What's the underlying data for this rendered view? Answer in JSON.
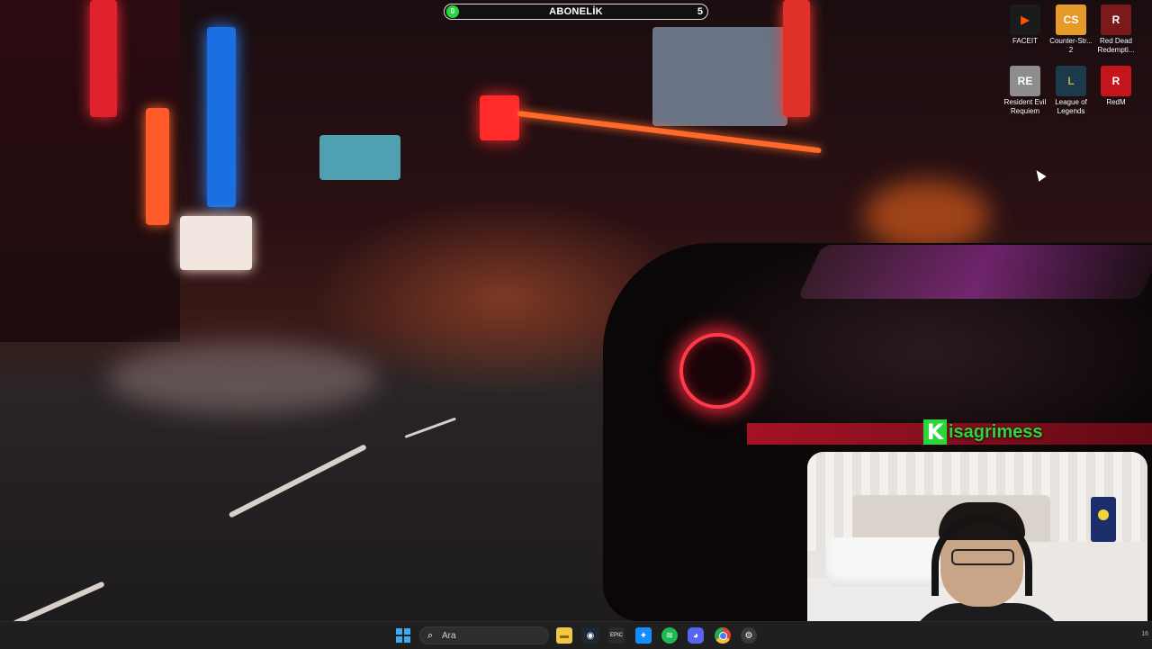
{
  "subscription_bar": {
    "badge": "0",
    "label": "ABONELİK",
    "count": "5"
  },
  "desktop_icons": [
    {
      "label": "FACEIT",
      "icon": "faceit-icon",
      "color": "#1b1b1b"
    },
    {
      "label": "Counter-Str... 2",
      "icon": "counter-strike-icon",
      "color": "#e69a2a"
    },
    {
      "label": "Red Dead Redempti...",
      "icon": "red-dead-redemption-icon",
      "color": "#7a1a1a"
    },
    {
      "label": "Resident Evil Requiem",
      "icon": "resident-evil-icon",
      "color": "#8d8d8d"
    },
    {
      "label": "League of Legends",
      "icon": "league-of-legends-icon",
      "color": "#1c3a4a"
    },
    {
      "label": "RedM",
      "icon": "redm-icon",
      "color": "#c4141c"
    }
  ],
  "brand": {
    "initial": "K",
    "rest": "isagrimess",
    "color": "#2bd63a"
  },
  "taskbar": {
    "search_placeholder": "Ara",
    "apps": [
      {
        "name": "file-explorer-icon",
        "glyph": "▬",
        "color": "#f2c744"
      },
      {
        "name": "steam-icon",
        "glyph": "◉",
        "color": "#1b2838"
      },
      {
        "name": "epic-games-icon",
        "glyph": "EPIC",
        "color": "#2a2a2a"
      },
      {
        "name": "battlenet-icon",
        "glyph": "✦",
        "color": "#148eff"
      },
      {
        "name": "spotify-icon",
        "glyph": "≋",
        "color": "#1db954"
      },
      {
        "name": "discord-icon",
        "glyph": "◕",
        "color": "#5865f2"
      },
      {
        "name": "chrome-icon",
        "glyph": "◎",
        "color": "#e44134"
      },
      {
        "name": "settings-icon",
        "glyph": "⚙",
        "color": "#3a3a3a"
      }
    ],
    "corner_text": "16"
  }
}
